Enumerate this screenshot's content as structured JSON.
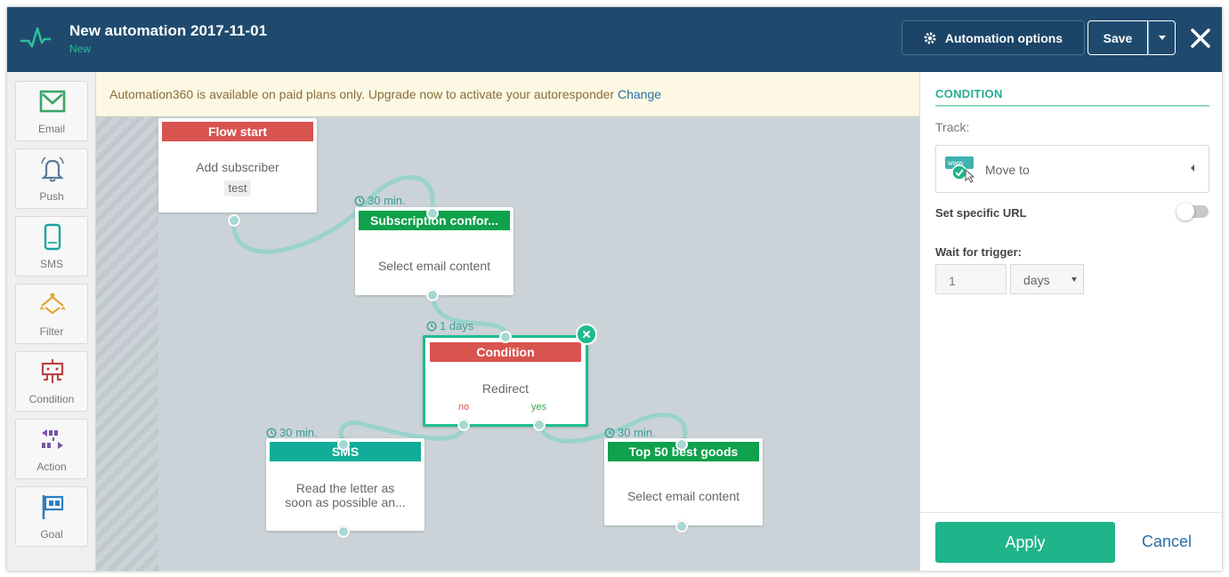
{
  "header": {
    "title": "New automation 2017-11-01",
    "status": "New",
    "options_label": "Automation options",
    "save_label": "Save"
  },
  "toolbar": {
    "items": [
      {
        "label": "Email",
        "icon": "email-icon"
      },
      {
        "label": "Push",
        "icon": "bell-icon"
      },
      {
        "label": "SMS",
        "icon": "phone-icon"
      },
      {
        "label": "Filter",
        "icon": "filter-icon"
      },
      {
        "label": "Condition",
        "icon": "condition-icon"
      },
      {
        "label": "Action",
        "icon": "action-icon"
      },
      {
        "label": "Goal",
        "icon": "goal-icon"
      }
    ]
  },
  "banner": {
    "text": "Automation360 is available on paid plans only. Upgrade now to activate your autoresponder",
    "link": "Change"
  },
  "flow": {
    "start": {
      "title": "Flow start",
      "body": "Add subscriber",
      "tag": "test"
    },
    "subscription": {
      "delay": "30 min.",
      "title": "Subscription confor...",
      "body": "Select email content"
    },
    "condition": {
      "delay": "1 days",
      "title": "Condition",
      "body": "Redirect",
      "no": "no",
      "yes": "yes"
    },
    "sms": {
      "delay": "30 min.",
      "title": "SMS",
      "body_line1": "Read the letter as",
      "body_line2": "soon as possible an..."
    },
    "top50": {
      "delay": "30 min.",
      "title": "Top 50 best goods",
      "body": "Select email content"
    }
  },
  "panel": {
    "heading": "CONDITION",
    "track_label": "Track:",
    "track_value": "Move to",
    "specific_url_label": "Set specific URL",
    "specific_url_on": false,
    "wait_label": "Wait for trigger:",
    "wait_value": "1",
    "wait_unit": "days",
    "apply_label": "Apply",
    "cancel_label": "Cancel"
  },
  "colors": {
    "header_bg": "#1f4a6e",
    "accent": "#1fb48a",
    "node_red": "#d9534f",
    "node_green": "#0fa14b",
    "node_teal": "#12ad98",
    "link": "#2a6ea4"
  }
}
